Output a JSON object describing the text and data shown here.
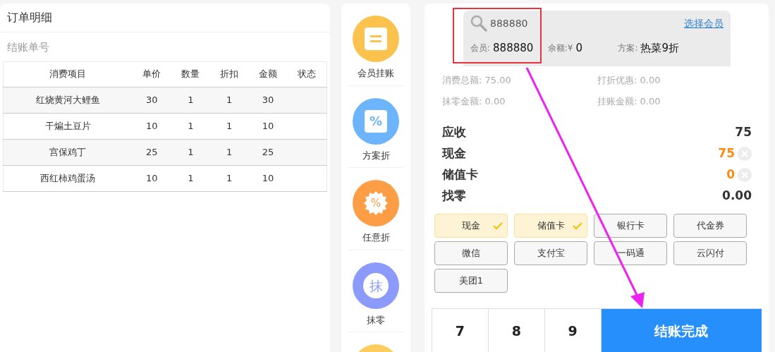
{
  "order": {
    "title": "订单明细",
    "checkout_no_label": "结账单号",
    "table": {
      "columns": [
        "消费项目",
        "单价",
        "数量",
        "折扣",
        "金额",
        "状态"
      ],
      "rows": [
        [
          "红烧黄河大鲤鱼",
          "30",
          "1",
          "1",
          "30",
          ""
        ],
        [
          "干煸土豆片",
          "10",
          "1",
          "1",
          "10",
          ""
        ],
        [
          "宫保鸡丁",
          "25",
          "1",
          "1",
          "25",
          ""
        ],
        [
          "西红柿鸡蛋汤",
          "10",
          "1",
          "1",
          "10",
          ""
        ]
      ]
    }
  },
  "actions": [
    {
      "kind": "ledger",
      "label": "会员挂账",
      "color": "#fbc24d"
    },
    {
      "kind": "percent",
      "label": "方案折",
      "glyph": "%",
      "color": "#6cb4fb"
    },
    {
      "kind": "burst",
      "label": "任意折",
      "glyph": "%",
      "color": "#fd9d46"
    },
    {
      "kind": "char",
      "label": "抹零",
      "glyph": "抹",
      "color": "#8c9afb"
    },
    {
      "kind": "partial",
      "color": "#fdcd5f"
    }
  ],
  "member": {
    "search_value": "888880",
    "select_link": "选择会员",
    "fields": [
      {
        "label": "会员:",
        "value": "888880"
      },
      {
        "label": "余额:¥",
        "value": "0"
      },
      {
        "label": "方案:",
        "value": "热菜9折"
      }
    ]
  },
  "summary": [
    {
      "label": "消费总额:",
      "value": "75.00"
    },
    {
      "label": "打折优惠:",
      "value": "0.00"
    },
    {
      "label": "抹零金额:",
      "value": "0.00"
    },
    {
      "label": "挂账金额:",
      "value": "0.00"
    }
  ],
  "amounts": [
    {
      "kind": "total",
      "label": "应收",
      "value": "75"
    },
    {
      "kind": "tender",
      "label": "现金",
      "value": "75"
    },
    {
      "kind": "tender",
      "label": "储值卡",
      "value": "0"
    },
    {
      "kind": "total",
      "label": "找零",
      "value": "0.00"
    }
  ],
  "payments": [
    {
      "label": "现金",
      "selected": true
    },
    {
      "label": "储值卡",
      "selected": true
    },
    {
      "label": "银行卡",
      "selected": false
    },
    {
      "label": "代金券",
      "selected": false
    },
    {
      "label": "微信",
      "selected": false
    },
    {
      "label": "支付宝",
      "selected": false
    },
    {
      "label": "一码通",
      "selected": false
    },
    {
      "label": "云闪付",
      "selected": false
    },
    {
      "label": "美团1",
      "selected": false
    }
  ],
  "keypad": {
    "keys": [
      "7",
      "8",
      "9"
    ],
    "confirm": "结账完成"
  }
}
